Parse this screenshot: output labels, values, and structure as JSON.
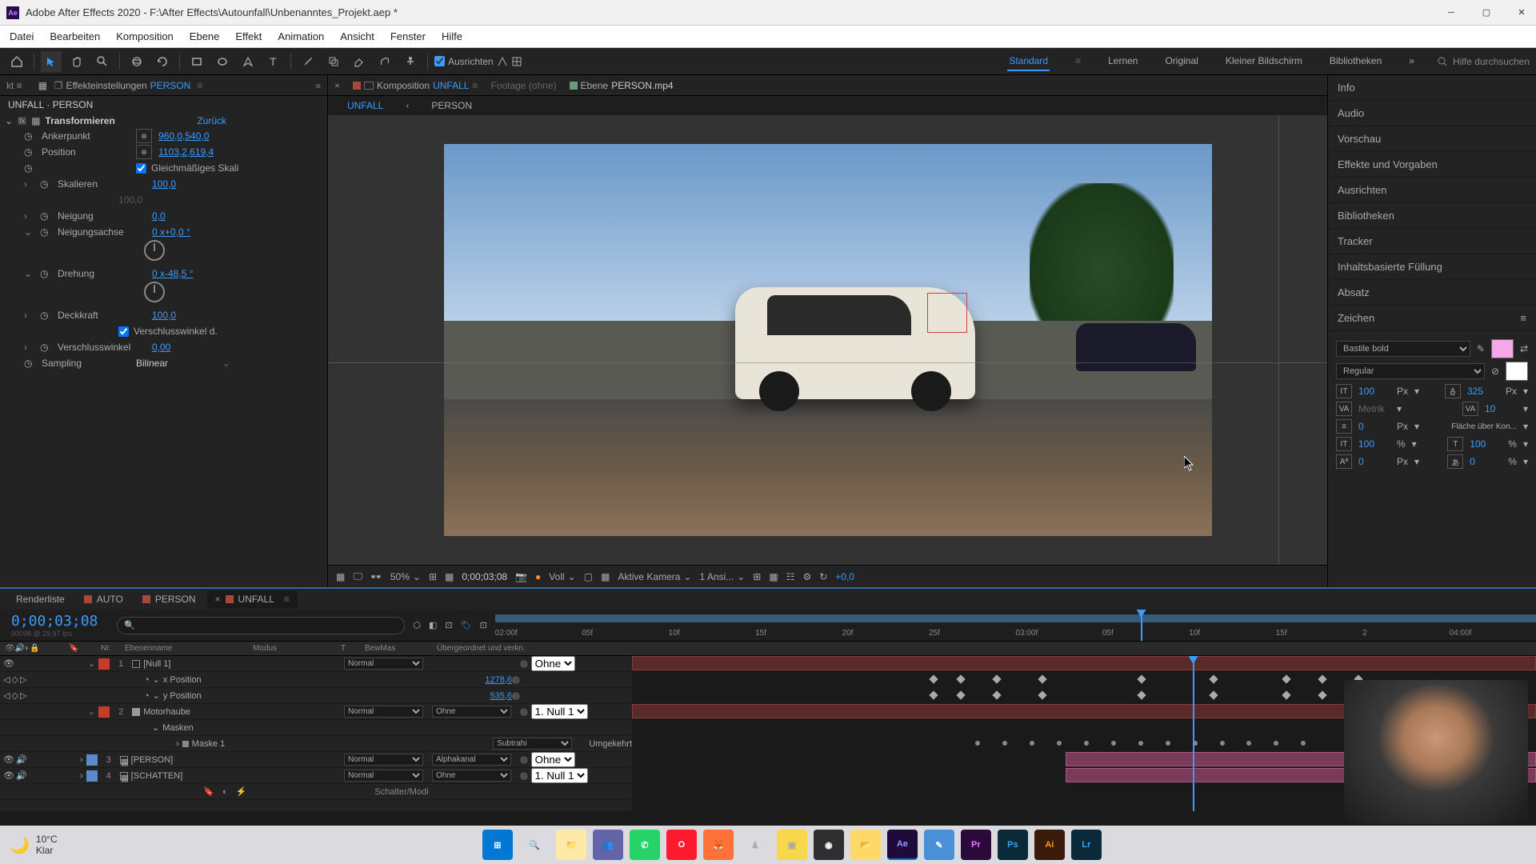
{
  "titlebar": {
    "app": "Ae",
    "title": "Adobe After Effects 2020 - F:\\After Effects\\Autounfall\\Unbenanntes_Projekt.aep *"
  },
  "menu": [
    "Datei",
    "Bearbeiten",
    "Komposition",
    "Ebene",
    "Effekt",
    "Animation",
    "Ansicht",
    "Fenster",
    "Hilfe"
  ],
  "toolbar": {
    "ausrichten": "Ausrichten",
    "workspaces": [
      "Standard",
      "Lernen",
      "Original",
      "Kleiner Bildschirm",
      "Bibliotheken"
    ],
    "active_workspace": "Standard",
    "search_placeholder": "Hilfe durchsuchen"
  },
  "left_panel": {
    "tab_label": "Effekteinstellungen",
    "tab_target": "PERSON",
    "breadcrumb": "UNFALL · PERSON",
    "fx_name": "Transformieren",
    "fx_reset": "Zurück",
    "props": {
      "ankerpunkt": {
        "label": "Ankerpunkt",
        "val": "960,0,540,0"
      },
      "position": {
        "label": "Position",
        "val": "1103,2,619,4"
      },
      "gleichmaessig": "Gleichmäßiges Skali",
      "skalieren": {
        "label": "Skalieren",
        "val": "100,0",
        "dim": "100,0"
      },
      "neigung": {
        "label": "Neigung",
        "val": "0,0"
      },
      "neigungsachse": {
        "label": "Neigungsachse",
        "val": "0 x+0,0 °"
      },
      "drehung": {
        "label": "Drehung",
        "val": "0 x-48,5 °"
      },
      "deckkraft": {
        "label": "Deckkraft",
        "val": "100,0"
      },
      "verschluss_check": "Verschlusswinkel d.",
      "verschlusswinkel": {
        "label": "Verschlusswinkel",
        "val": "0,00"
      },
      "sampling": {
        "label": "Sampling",
        "val": "Bilinear"
      }
    }
  },
  "viewer": {
    "tabs": {
      "komposition_label": "Komposition",
      "komposition_target": "UNFALL",
      "footage": "Footage  (ohne)",
      "ebene_label": "Ebene",
      "ebene_target": "PERSON.mp4"
    },
    "comp_tabs": [
      "UNFALL",
      "PERSON"
    ],
    "controls": {
      "zoom": "50%",
      "timecode": "0;00;03;08",
      "res": "Voll",
      "camera": "Aktive Kamera",
      "views": "1 Ansi...",
      "exposure": "+0,0"
    }
  },
  "right_panel": {
    "items": [
      "Info",
      "Audio",
      "Vorschau",
      "Effekte und Vorgaben",
      "Ausrichten",
      "Bibliotheken",
      "Tracker",
      "Inhaltsbasierte Füllung",
      "Absatz"
    ],
    "zeichen": {
      "title": "Zeichen",
      "font": "Bastile bold",
      "style": "Regular",
      "size": "100",
      "size_unit": "Px",
      "leading": "325",
      "leading_unit": "Px",
      "kerning": "Metrik",
      "tracking": "10",
      "stroke": "0",
      "stroke_unit": "Px",
      "fill_over": "Fläche über Kon...",
      "vscale": "100",
      "hscale": "100",
      "baseline": "0",
      "baseline_unit": "Px",
      "tsume": "0",
      "pct": "%"
    }
  },
  "timeline": {
    "tabs": [
      {
        "label": "Renderliste",
        "color": ""
      },
      {
        "label": "AUTO",
        "color": "#a8483a"
      },
      {
        "label": "PERSON",
        "color": "#a8483a"
      },
      {
        "label": "UNFALL",
        "color": "#a8483a"
      }
    ],
    "active_tab": "UNFALL",
    "timecode": "0;00;03;08",
    "subframe": "00098 @ 29,97 fps",
    "ruler": [
      "02:00f",
      "05f",
      "10f",
      "15f",
      "20f",
      "25f",
      "03:00f",
      "05f",
      "10f",
      "15f",
      "2",
      "04:00f"
    ],
    "cols": {
      "nr": "Nr.",
      "name": "Ebenenname",
      "modus": "Modus",
      "t": "T",
      "bewmas": "BewMas",
      "parent": "Übergeordnet und verkn."
    },
    "layers": [
      {
        "num": "1",
        "name": "[Null 1]",
        "color": "#c83a2a",
        "mode": "Normal",
        "trk": "",
        "parent": "Ohne",
        "type": "null"
      },
      {
        "num": "",
        "name": "x Position",
        "val": "1278,6",
        "indent": 2,
        "type": "prop"
      },
      {
        "num": "",
        "name": "y Position",
        "val": "535,6",
        "indent": 2,
        "type": "prop"
      },
      {
        "num": "2",
        "name": "Motorhaube",
        "color": "#c83a2a",
        "mode": "Normal",
        "trk": "Ohne",
        "parent": "1. Null 1",
        "type": "solid"
      },
      {
        "num": "",
        "name": "Masken",
        "indent": 1,
        "type": "group"
      },
      {
        "num": "",
        "name": "Maske 1",
        "mode": "Subtrahi",
        "trk": "Umgekehrt",
        "indent": 2,
        "type": "mask"
      },
      {
        "num": "3",
        "name": "[PERSON]",
        "color": "#5a8ac8",
        "mode": "Normal",
        "trk": "Alphakanal",
        "parent": "Ohne",
        "type": "comp"
      },
      {
        "num": "4",
        "name": "[SCHATTEN]",
        "color": "#5a8ac8",
        "mode": "Normal",
        "trk": "Ohne",
        "parent": "1. Null 1",
        "type": "comp"
      }
    ],
    "footer": "Schalter/Modi"
  },
  "taskbar": {
    "temp": "10°C",
    "cond": "Klar"
  }
}
